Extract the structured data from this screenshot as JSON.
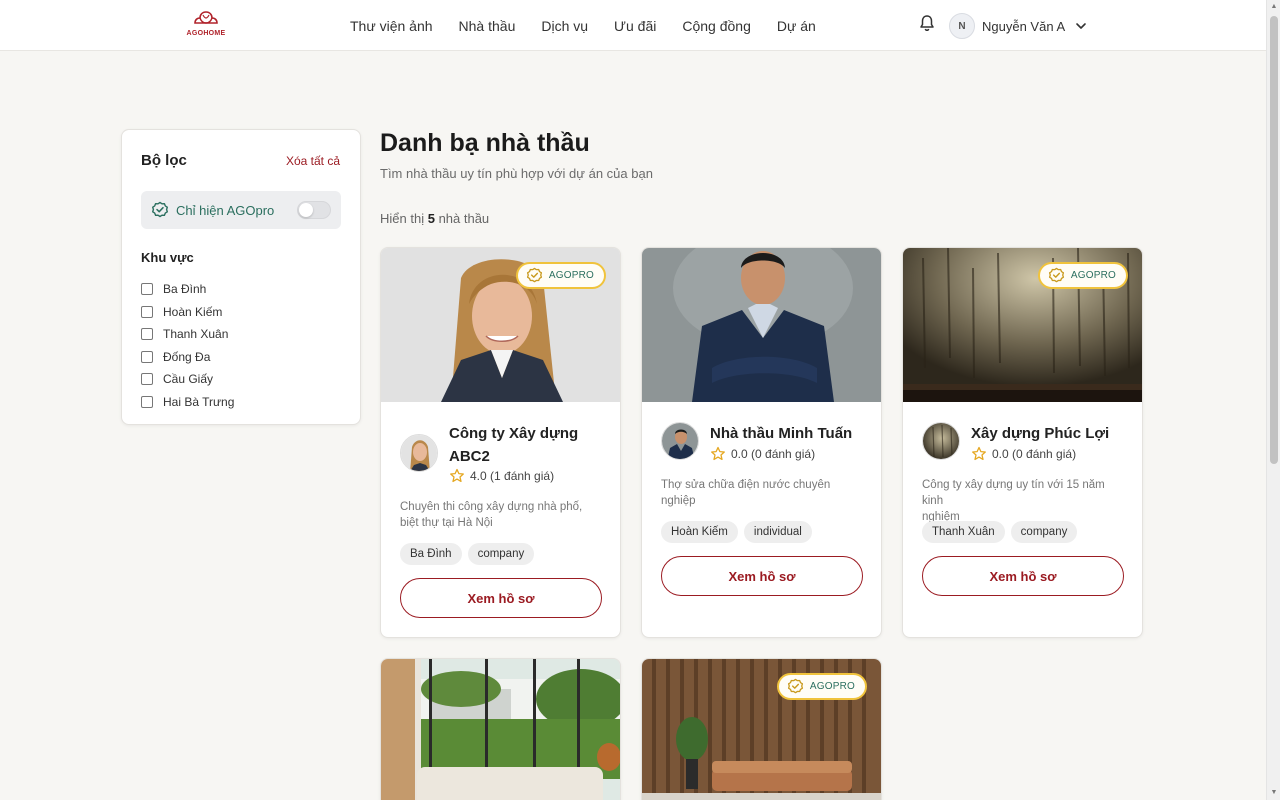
{
  "header": {
    "logo_text": "AGOHOME",
    "nav": [
      "Thư viện ảnh",
      "Nhà thầu",
      "Dịch vụ",
      "Ưu đãi",
      "Cộng đồng",
      "Dự án"
    ],
    "user": {
      "initial": "N",
      "name": "Nguyễn Văn A"
    }
  },
  "filter": {
    "title": "Bộ lọc",
    "clear_all": "Xóa tất cả",
    "agopro_toggle": {
      "label": "Chỉ hiện AGOpro",
      "checked": false
    },
    "area_title": "Khu vực",
    "areas": [
      "Ba Đình",
      "Hoàn Kiếm",
      "Thanh Xuân",
      "Đống Đa",
      "Cầu Giấy",
      "Hai Bà Trưng"
    ]
  },
  "main": {
    "title": "Danh bạ nhà thầu",
    "subtitle": "Tìm nhà thầu uy tín phù hợp với dự án của bạn",
    "count_prefix": "Hiển thị",
    "count": "5",
    "count_suffix": "nhà thầu"
  },
  "badge_label": "AGOPRO",
  "view_profile": "Xem hồ sơ",
  "cards": [
    {
      "name_line1": "Công ty Xây dựng",
      "name_line2": "ABC2",
      "rating": "4.0 (1 đánh giá)",
      "desc_line1": "Chuyên thi công xây dựng nhà phố,",
      "desc_line2": "biệt thự tại Hà Nội",
      "tags": [
        "Ba Đình",
        "company"
      ],
      "agopro": true
    },
    {
      "name_line1": "Nhà thầu Minh Tuấn",
      "rating": "0.0 (0 đánh giá)",
      "desc_line1": "Thợ sửa chữa điện nước chuyên",
      "desc_line2": "nghiệp",
      "tags": [
        "Hoàn Kiếm",
        "individual"
      ],
      "agopro": false
    },
    {
      "name_line1": "Xây dựng Phúc Lợi",
      "rating": "0.0 (0 đánh giá)",
      "desc_line1": "Công ty xây dựng uy tín với 15 năm kinh",
      "desc_line2": "nghiệm",
      "tags": [
        "Thanh Xuân",
        "company"
      ],
      "agopro": true
    },
    {
      "agopro": false
    },
    {
      "agopro": true
    }
  ],
  "colors": {
    "brand": "#9b1b22",
    "agopro_green": "#2b6f5f",
    "badge_gold": "#f0c33c"
  }
}
